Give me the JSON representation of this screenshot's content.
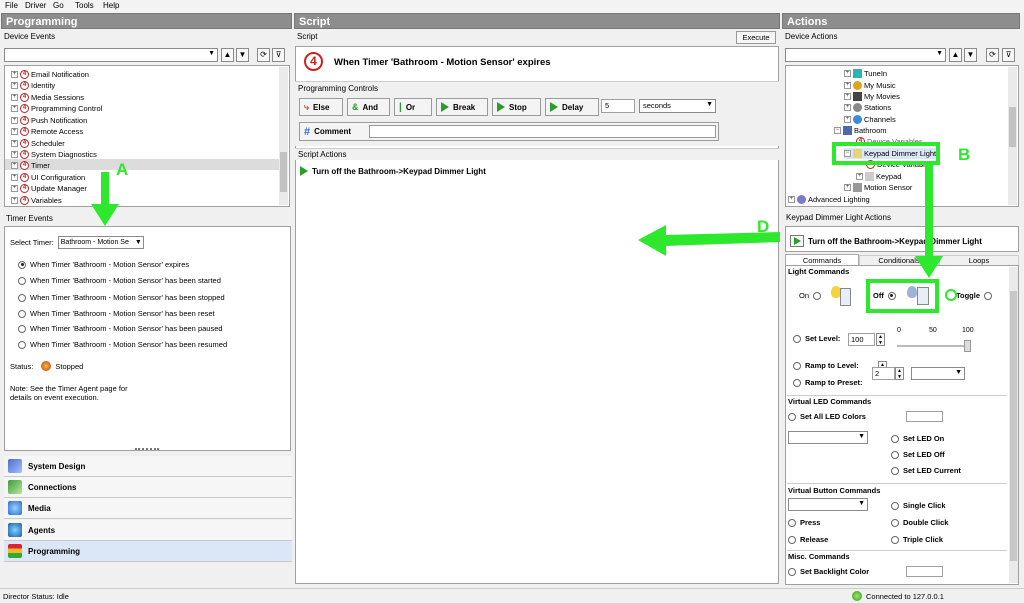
{
  "menu": [
    "File",
    "Driver",
    "Go",
    "Tools",
    "Help"
  ],
  "programming": {
    "title": "Programming",
    "device_events_label": "Device Events",
    "tree": [
      "Email Notification",
      "Identity",
      "Media Sessions",
      "Programming Control",
      "Push Notification",
      "Remote Access",
      "Scheduler",
      "System Diagnostics",
      "Timer",
      "UI Configuration",
      "Update Manager",
      "Variables"
    ],
    "timer_events_label": "Timer Events",
    "select_timer_label": "Select Timer:",
    "select_timer_value": "Bathroom - Motion Se",
    "events": [
      "When Timer 'Bathroom - Motion Sensor' expires",
      "When Timer 'Bathroom - Motion Sensor' has been started",
      "When Timer 'Bathroom - Motion Sensor' has been stopped",
      "When Timer 'Bathroom - Motion Sensor' has been reset",
      "When Timer 'Bathroom - Motion Sensor' has been paused",
      "When Timer 'Bathroom - Motion Sensor' has been resumed"
    ],
    "status_label": "Status:",
    "status_value": "Stopped",
    "note": "Note: See the Timer Agent page for details on event execution.",
    "nav": [
      "System Design",
      "Connections",
      "Media",
      "Agents",
      "Programming"
    ]
  },
  "script": {
    "title": "Script",
    "script_label": "Script",
    "execute": "Execute",
    "heading": "When Timer 'Bathroom - Motion Sensor' expires",
    "controls_label": "Programming Controls",
    "controls": [
      "Else",
      "And",
      "Or",
      "Break",
      "Stop",
      "Delay"
    ],
    "delay_value": "5",
    "delay_unit": "seconds",
    "comment": "Comment",
    "actions_label": "Script Actions",
    "action": "Turn off the Bathroom->Keypad Dimmer Light"
  },
  "actions": {
    "title": "Actions",
    "device_actions_label": "Device Actions",
    "tree": [
      "TuneIn",
      "My Music",
      "My Movies",
      "Stations",
      "Channels",
      "Bathroom",
      "Device Variables",
      "Keypad Dimmer Light",
      "Device Variables",
      "Keypad",
      "Motion Sensor",
      "Advanced Lighting"
    ],
    "kd_actions_label": "Keypad Dimmer Light Actions",
    "kd_action": "Turn off the Bathroom->Keypad Dimmer Light",
    "tabs": [
      "Commands",
      "Conditionals",
      "Loops"
    ],
    "light_commands": "Light Commands",
    "on": "On",
    "off": "Off",
    "toggle": "Toggle",
    "set_level": "Set Level:",
    "level_value": "100",
    "slider_ticks": [
      "0",
      "50",
      "100"
    ],
    "ramp_level": "Ramp to Level:",
    "ramp_preset": "Ramp to Preset:",
    "preset_value": "2",
    "virtual_led": "Virtual LED Commands",
    "set_all_led": "Set All LED Colors",
    "led_on": "Set LED On",
    "led_off": "Set LED Off",
    "led_current": "Set LED Current",
    "virtual_button": "Virtual Button Commands",
    "single": "Single Click",
    "double": "Double Click",
    "triple": "Triple Click",
    "press": "Press",
    "release": "Release",
    "misc": "Misc. Commands",
    "backlight": "Set Backlight Color"
  },
  "status": {
    "left": "Director Status: Idle",
    "right": "Connected to 127.0.0.1"
  },
  "annotations": [
    "A",
    "B",
    "D"
  ],
  "colors": {
    "annotation": "#2ee82e",
    "header": "#8d8d8d"
  }
}
